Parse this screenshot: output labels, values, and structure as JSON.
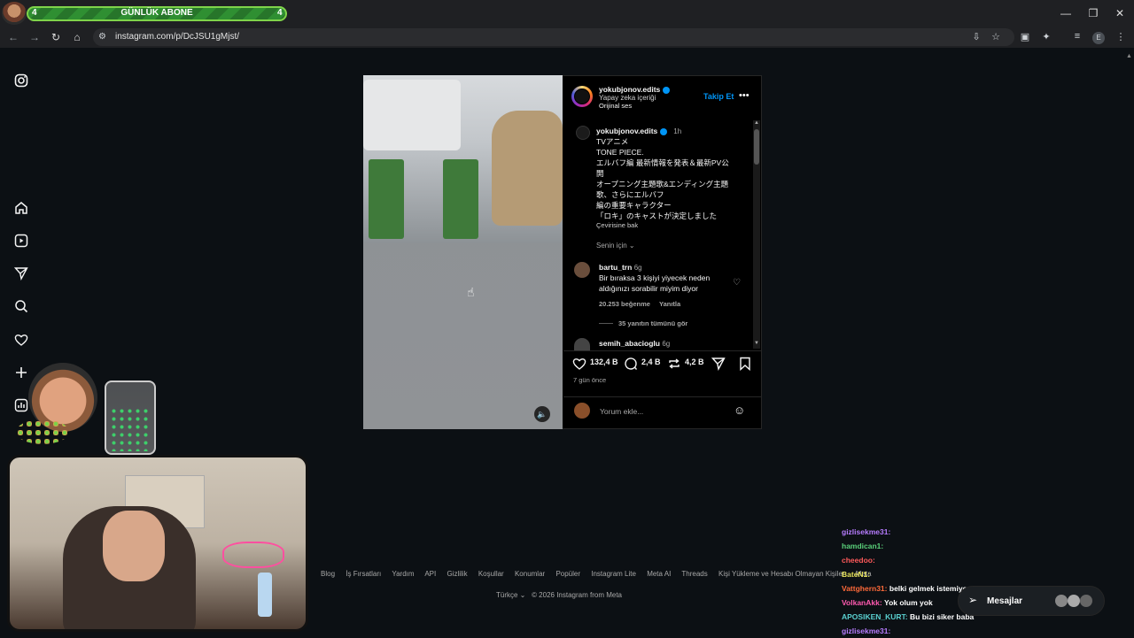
{
  "browser": {
    "url": "instagram.com/p/DcJSU1gMjst/",
    "subscriber_bar": {
      "label": "GÜNLÜK ABONE",
      "left_value": "4",
      "right_value": "4"
    }
  },
  "post": {
    "username": "yokubjonov.edits",
    "ai_label": "Yapay zeka içeriği",
    "audio": "Orijinal ses",
    "follow": "Takip Et",
    "caption_user": "yokubjonov.edits",
    "caption_time": "1h",
    "caption_lines": [
      "TVアニメ",
      "TONE PIECE.",
      "エルバフ編 最新情報を発表＆最新PV公",
      "開",
      "オープニング主題歌&エンディング主題",
      "歌、さらにエルバフ",
      "編の重要キャラクター",
      "「ロキ」のキャストが決定しました"
    ],
    "see_translation": "Çevirisine bak",
    "for_you": "Senin için",
    "comment1": {
      "user": "bartu_trn",
      "time": "6g",
      "text_line1": "Bir bıraksa 3 kişiyi yiyecek neden",
      "text_line2": "aldığınızı sorabilir miyim diyor",
      "likes": "20.253 beğenme",
      "reply": "Yanıtla",
      "view_replies": "35 yanıtın tümünü gör"
    },
    "comment2": {
      "user": "semih_abacioglu",
      "time": "6g"
    },
    "likes": "132,4 B",
    "comments": "2,4 B",
    "reposts": "4,2 B",
    "date": "7 gün önce",
    "add_comment": "Yorum ekle..."
  },
  "footer": {
    "links": [
      "Blog",
      "İş Fırsatları",
      "Yardım",
      "API",
      "Gizlilik",
      "Koşullar",
      "Konumlar",
      "Popüler",
      "Instagram Lite",
      "Meta AI",
      "Threads",
      "Kişi Yükleme ve Hesabı Olmayan Kişiler",
      "Meta"
    ],
    "language": "Türkçe",
    "copyright": "© 2026 Instagram from Meta"
  },
  "chat": [
    {
      "user": "gizlisekme31:",
      "msg": "",
      "color": "#b77cff"
    },
    {
      "user": "hamdican1:",
      "msg": "",
      "color": "#5ad07a"
    },
    {
      "user": "cheedoo:",
      "msg": "",
      "color": "#ff5a5a"
    },
    {
      "user": "BateN1:",
      "msg": "",
      "color": "#e8e35a"
    },
    {
      "user": "Vattghern31:",
      "msg": "belki gelmek istemiyo",
      "color": "#ff6a3a"
    },
    {
      "user": "VolkanAkk:",
      "msg": "Yok olum yok",
      "color": "#ff5ab0"
    },
    {
      "user": "APOSIKEN_KURT:",
      "msg": "Bu bizi siker baba",
      "color": "#5ad0d0"
    },
    {
      "user": "gizlisekme31:",
      "msg": "",
      "color": "#b77cff"
    }
  ],
  "messages_label": "Mesajlar",
  "icons": [
    "instagram-logo-icon",
    "home-icon",
    "reels-icon",
    "send-icon",
    "search-icon",
    "heart-icon",
    "plus-icon",
    "stats-icon"
  ]
}
